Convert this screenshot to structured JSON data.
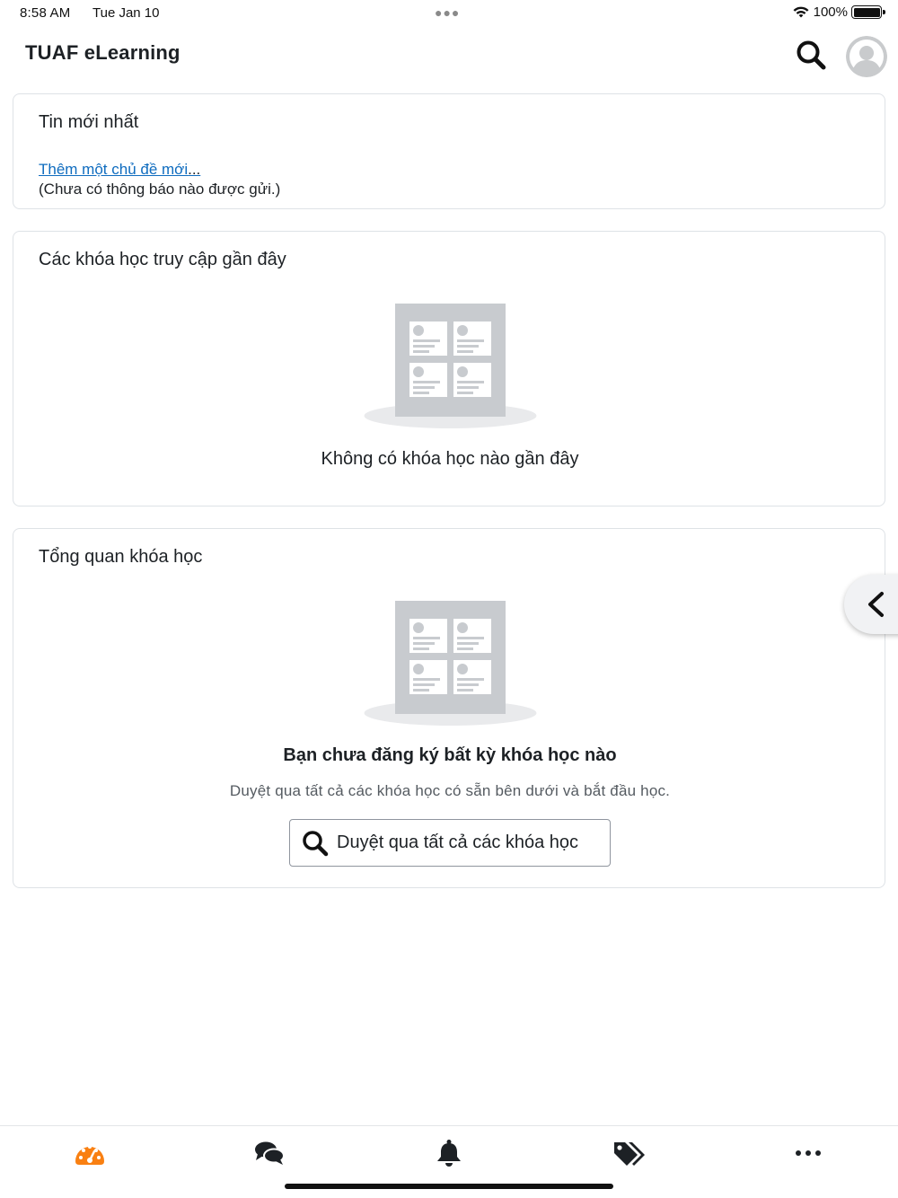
{
  "status_bar": {
    "time": "8:58 AM",
    "date": "Tue Jan 10",
    "battery": "100%"
  },
  "header": {
    "title": "TUAF eLearning",
    "search_icon": "search-icon",
    "avatar_icon": "user-avatar-icon"
  },
  "news": {
    "title": "Tin mới nhất",
    "add_topic_link": "Thêm một chủ đề mới",
    "ellipsis": "...",
    "empty_text": "(Chưa có thông báo nào được gửi.)"
  },
  "recent_courses": {
    "title": "Các khóa học truy cập gần đây",
    "empty_text": "Không có khóa học nào gần đây"
  },
  "course_overview": {
    "title": "Tổng quan khóa học",
    "empty_heading": "Bạn chưa đăng ký bất kỳ khóa học nào",
    "empty_sub": "Duyệt qua tất cả các khóa học có sẵn bên dưới và bắt đầu học.",
    "browse_button": "Duyệt qua tất cả các khóa học"
  },
  "tab_bar": {
    "items": [
      {
        "icon": "dashboard-icon",
        "active": true
      },
      {
        "icon": "messages-icon",
        "active": false
      },
      {
        "icon": "bell-icon",
        "active": false
      },
      {
        "icon": "tags-icon",
        "active": false
      },
      {
        "icon": "more-icon",
        "active": false
      }
    ]
  },
  "colors": {
    "accent": "#f98012",
    "link": "#0f6cbf",
    "border": "#dee2e6",
    "illustration": "#c8cbcf"
  }
}
